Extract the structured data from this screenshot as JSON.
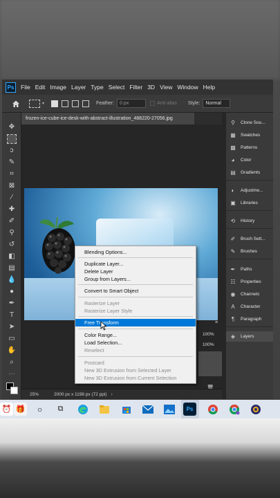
{
  "app": {
    "logo_text": "Ps",
    "menu": [
      "File",
      "Edit",
      "Image",
      "Layer",
      "Type",
      "Select",
      "Filter",
      "3D",
      "View",
      "Window",
      "Help"
    ]
  },
  "options_bar": {
    "feather_label": "Feather:",
    "feather_value": "0 px",
    "antialias_label": "Anti-alias",
    "style_label": "Style:",
    "style_value": "Normal"
  },
  "document": {
    "tab_title": "frozen-ice-cube-ice-desk-with-abstract-illustration_488220-27056.jpg"
  },
  "status": {
    "zoom": "25%",
    "dimensions": "2000 px x 1198 px (72 ppi)"
  },
  "layers_bits": {
    "opacity": "100%",
    "fill": "100%"
  },
  "panels": [
    {
      "icon": "clone-source-icon",
      "label": "Clone Sou..."
    },
    {
      "icon": "swatches-icon",
      "label": "Swatches"
    },
    {
      "icon": "patterns-icon",
      "label": "Patterns"
    },
    {
      "icon": "color-icon",
      "label": "Color"
    },
    {
      "icon": "gradients-icon",
      "label": "Gradients"
    },
    {
      "icon": "adjustments-icon",
      "label": "Adjustme..."
    },
    {
      "icon": "libraries-icon",
      "label": "Libraries"
    },
    {
      "icon": "history-icon",
      "label": "History"
    },
    {
      "icon": "brush-settings-icon",
      "label": "Brush Sett..."
    },
    {
      "icon": "brushes-icon",
      "label": "Brushes"
    },
    {
      "icon": "paths-icon",
      "label": "Paths"
    },
    {
      "icon": "properties-icon",
      "label": "Properties"
    },
    {
      "icon": "channels-icon",
      "label": "Channels"
    },
    {
      "icon": "character-icon",
      "label": "Character"
    },
    {
      "icon": "paragraph-icon",
      "label": "Paragraph"
    },
    {
      "icon": "layers-icon",
      "label": "Layers"
    }
  ],
  "context_menu": {
    "items": [
      {
        "label": "Blending Options...",
        "state": "enabled"
      },
      {
        "label": "Duplicate Layer...",
        "state": "enabled"
      },
      {
        "label": "Delete Layer",
        "state": "enabled"
      },
      {
        "label": "Group from Layers...",
        "state": "enabled"
      },
      {
        "label": "Convert to Smart Object",
        "state": "enabled"
      },
      {
        "label": "Rasterize Layer",
        "state": "disabled"
      },
      {
        "label": "Rasterize Layer Style",
        "state": "disabled"
      },
      {
        "label": "Free Transform",
        "state": "highlighted"
      },
      {
        "label": "Color Range...",
        "state": "enabled"
      },
      {
        "label": "Load Selection...",
        "state": "enabled"
      },
      {
        "label": "Reselect",
        "state": "disabled"
      },
      {
        "label": "Postcard",
        "state": "disabled"
      },
      {
        "label": "New 3D Extrusion from Selected Layer",
        "state": "disabled"
      },
      {
        "label": "New 3D Extrusion from Current Selection",
        "state": "disabled"
      }
    ]
  },
  "taskbar": {
    "icons": [
      "alarm-clock-icon",
      "gift-icon",
      "start-circle-icon",
      "task-view-icon",
      "edge-icon",
      "file-explorer-icon",
      "store-icon",
      "mail-icon",
      "photos-icon",
      "photoshop-icon",
      "chrome-icon",
      "chrome-profile-icon",
      "app-icon"
    ],
    "ps_label": "Ps"
  },
  "colors": {
    "accent": "#0078d7",
    "ps_blue": "#31a8ff",
    "panel_bg": "#3a3a3a"
  }
}
